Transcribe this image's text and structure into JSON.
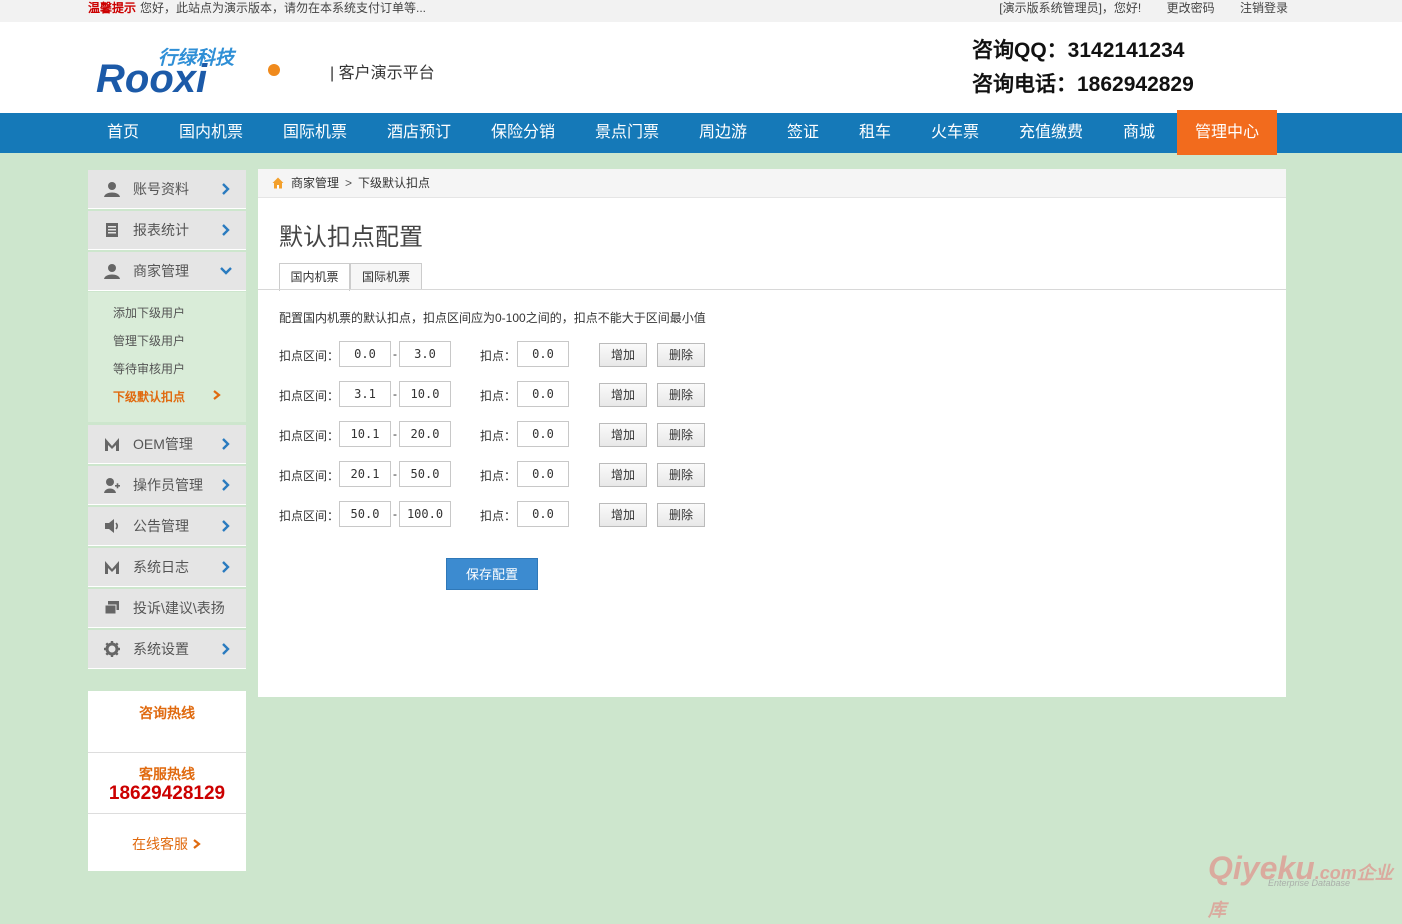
{
  "topbar": {
    "notice_label": "温馨提示",
    "notice_text": "您好，此站点为演示版本，请勿在本系统支付订单等...",
    "greeting": "[演示版系统管理员]，您好!",
    "change_password": "更改密码",
    "logout": "注销登录"
  },
  "header": {
    "logo_cn": "行绿科技",
    "logo_en": "Rooxi",
    "platform": "| 客户演示平台",
    "qq": "咨询QQ：3142141234",
    "phone": "咨询电话：1862942829"
  },
  "nav": [
    "首页",
    "国内机票",
    "国际机票",
    "酒店预订",
    "保险分销",
    "景点门票",
    "周边游",
    "签证",
    "租车",
    "火车票",
    "充值缴费",
    "商城",
    "管理中心"
  ],
  "sidebar": {
    "items": [
      {
        "label": "账号资料",
        "icon": "user-icon"
      },
      {
        "label": "报表统计",
        "icon": "report-icon"
      },
      {
        "label": "商家管理",
        "icon": "user-icon"
      },
      {
        "label": "OEM管理",
        "icon": "oem-icon"
      },
      {
        "label": "操作员管理",
        "icon": "add-user-icon"
      },
      {
        "label": "公告管理",
        "icon": "speaker-icon"
      },
      {
        "label": "系统日志",
        "icon": "log-icon"
      },
      {
        "label": "投诉\\建议\\表扬",
        "icon": "message-icon"
      },
      {
        "label": "系统设置",
        "icon": "gear-icon"
      }
    ],
    "sub_items": [
      "添加下级用户",
      "管理下级用户",
      "等待审核用户",
      "下级默认扣点"
    ],
    "hotline": {
      "consult_title": "咨询热线",
      "service_title": "客服热线",
      "service_phone": "18629428129",
      "online": "在线客服"
    }
  },
  "breadcrumb": {
    "parent": "商家管理",
    "current": "下级默认扣点"
  },
  "main": {
    "title": "默认扣点配置",
    "tabs": [
      "国内机票",
      "国际机票"
    ],
    "description": "配置国内机票的默认扣点，扣点区间应为0-100之间的，扣点不能大于区间最小值",
    "range_label": "扣点区间：",
    "point_label": "扣点：",
    "add_label": "增加",
    "delete_label": "删除",
    "save_label": "保存配置",
    "rows": [
      {
        "from": "0.0",
        "to": "3.0",
        "point": "0.0"
      },
      {
        "from": "3.1",
        "to": "10.0",
        "point": "0.0"
      },
      {
        "from": "10.1",
        "to": "20.0",
        "point": "0.0"
      },
      {
        "from": "20.1",
        "to": "50.0",
        "point": "0.0"
      },
      {
        "from": "50.0",
        "to": "100.0",
        "point": "0.0"
      }
    ]
  },
  "watermark": {
    "brand": "Qiyeku",
    "cn": ".com企业库",
    "sub": "Enterprise Database"
  },
  "colors": {
    "nav": "#1579b8",
    "active": "#f26b1d",
    "page_bg": "#cde6cd",
    "accent": "#e06a0f",
    "phone": "#cc0000"
  }
}
